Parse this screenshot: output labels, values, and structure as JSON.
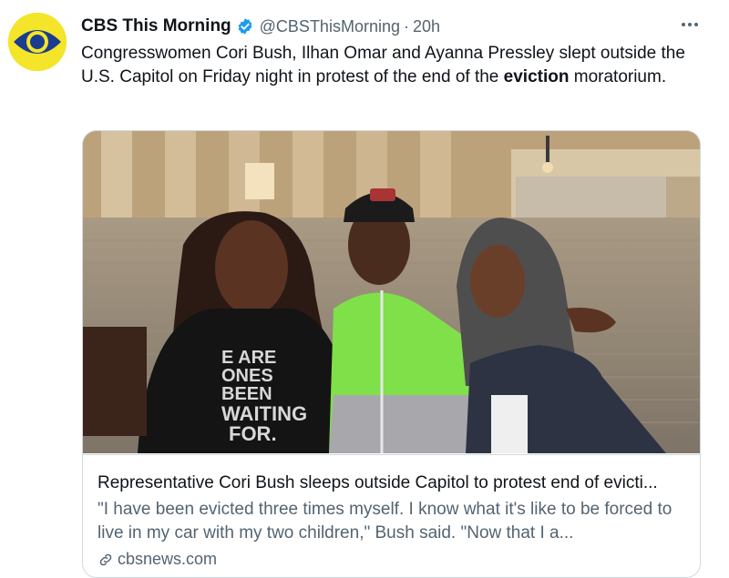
{
  "tweet": {
    "author": {
      "display_name": "CBS This Morning",
      "handle": "@CBSThisMorning",
      "verified": true,
      "avatar_icon": "cbs-eye-logo-icon",
      "avatar_color": "#f4e52a"
    },
    "separator": "·",
    "time": "20h",
    "more_icon": "more-horizontal-icon",
    "text_before": "Congresswomen Cori Bush, Ilhan Omar and Ayanna Pressley slept outside the U.S. Capitol on Friday night in protest of the end of the ",
    "text_highlight": "eviction",
    "text_after": " moratorium."
  },
  "card": {
    "image_icon": "photo-three-congresswomen-capitol",
    "shirt_text": "WE ARE THE ONES WE'VE BEEN WAITING FOR.",
    "title": "Representative Cori Bush sleeps outside Capitol to protest end of evicti...",
    "description": "\"I have been evicted three times myself. I know what it's like to be forced to live in my car with my two children,\" Bush said. \"Now that I a...",
    "domain": "cbsnews.com",
    "link_icon": "link-icon"
  },
  "colors": {
    "text_primary": "#0f1419",
    "text_secondary": "#536471",
    "verified_blue": "#1d9bf0",
    "border": "#cfd9de"
  }
}
